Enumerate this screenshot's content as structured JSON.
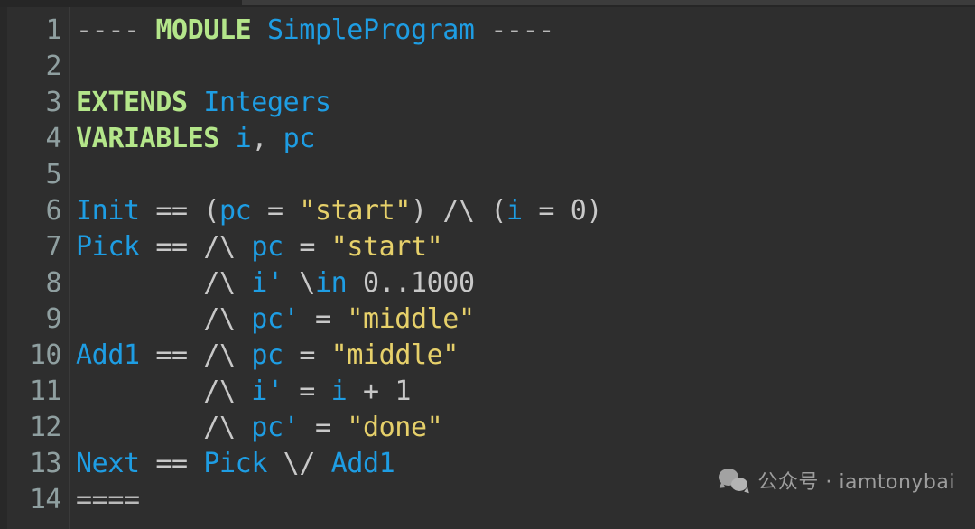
{
  "editor": {
    "language": "TLA+",
    "background_color": "#2e2e2e",
    "gutter_color": "#2e2e2e",
    "colors": {
      "keyword": "#b4e68a",
      "identifier": "#1e9de3",
      "string": "#e6d06a",
      "operator": "#c8c8c8",
      "line_number": "#8f9fa0",
      "background": "#2e2e2e"
    }
  },
  "gutter": {
    "line_numbers": [
      "1",
      "2",
      "3",
      "4",
      "5",
      "6",
      "7",
      "8",
      "9",
      "10",
      "11",
      "12",
      "13",
      "14"
    ]
  },
  "code": {
    "lines": [
      {
        "n": "1",
        "tokens": [
          {
            "t": "dash",
            "s": "----"
          },
          {
            "t": "plain",
            "s": " "
          },
          {
            "t": "kw",
            "s": "MODULE"
          },
          {
            "t": "plain",
            "s": " "
          },
          {
            "t": "id",
            "s": "SimpleProgram"
          },
          {
            "t": "plain",
            "s": " "
          },
          {
            "t": "dash",
            "s": "----"
          }
        ]
      },
      {
        "n": "2",
        "tokens": []
      },
      {
        "n": "3",
        "tokens": [
          {
            "t": "kw",
            "s": "EXTENDS"
          },
          {
            "t": "plain",
            "s": " "
          },
          {
            "t": "id",
            "s": "Integers"
          }
        ]
      },
      {
        "n": "4",
        "tokens": [
          {
            "t": "kw",
            "s": "VARIABLES"
          },
          {
            "t": "plain",
            "s": " "
          },
          {
            "t": "id",
            "s": "i"
          },
          {
            "t": "op",
            "s": ","
          },
          {
            "t": "plain",
            "s": " "
          },
          {
            "t": "id",
            "s": "pc"
          }
        ]
      },
      {
        "n": "5",
        "tokens": []
      },
      {
        "n": "6",
        "tokens": [
          {
            "t": "id",
            "s": "Init"
          },
          {
            "t": "plain",
            "s": " "
          },
          {
            "t": "op",
            "s": "=="
          },
          {
            "t": "plain",
            "s": " "
          },
          {
            "t": "op",
            "s": "("
          },
          {
            "t": "id",
            "s": "pc"
          },
          {
            "t": "plain",
            "s": " "
          },
          {
            "t": "op",
            "s": "="
          },
          {
            "t": "plain",
            "s": " "
          },
          {
            "t": "str",
            "s": "\"start\""
          },
          {
            "t": "op",
            "s": ")"
          },
          {
            "t": "plain",
            "s": " "
          },
          {
            "t": "op",
            "s": "/\\"
          },
          {
            "t": "plain",
            "s": " "
          },
          {
            "t": "op",
            "s": "("
          },
          {
            "t": "id",
            "s": "i"
          },
          {
            "t": "plain",
            "s": " "
          },
          {
            "t": "op",
            "s": "="
          },
          {
            "t": "plain",
            "s": " "
          },
          {
            "t": "num",
            "s": "0"
          },
          {
            "t": "op",
            "s": ")"
          }
        ]
      },
      {
        "n": "7",
        "tokens": [
          {
            "t": "id",
            "s": "Pick"
          },
          {
            "t": "plain",
            "s": " "
          },
          {
            "t": "op",
            "s": "=="
          },
          {
            "t": "plain",
            "s": " "
          },
          {
            "t": "op",
            "s": "/\\"
          },
          {
            "t": "plain",
            "s": " "
          },
          {
            "t": "id",
            "s": "pc"
          },
          {
            "t": "plain",
            "s": " "
          },
          {
            "t": "op",
            "s": "="
          },
          {
            "t": "plain",
            "s": " "
          },
          {
            "t": "str",
            "s": "\"start\""
          }
        ]
      },
      {
        "n": "8",
        "tokens": [
          {
            "t": "plain",
            "s": "        "
          },
          {
            "t": "op",
            "s": "/\\"
          },
          {
            "t": "plain",
            "s": " "
          },
          {
            "t": "id",
            "s": "i'"
          },
          {
            "t": "plain",
            "s": " "
          },
          {
            "t": "op",
            "s": "\\"
          },
          {
            "t": "id",
            "s": "in"
          },
          {
            "t": "plain",
            "s": " "
          },
          {
            "t": "num",
            "s": "0..1000"
          }
        ]
      },
      {
        "n": "9",
        "tokens": [
          {
            "t": "plain",
            "s": "        "
          },
          {
            "t": "op",
            "s": "/\\"
          },
          {
            "t": "plain",
            "s": " "
          },
          {
            "t": "id",
            "s": "pc'"
          },
          {
            "t": "plain",
            "s": " "
          },
          {
            "t": "op",
            "s": "="
          },
          {
            "t": "plain",
            "s": " "
          },
          {
            "t": "str",
            "s": "\"middle\""
          }
        ]
      },
      {
        "n": "10",
        "tokens": [
          {
            "t": "id",
            "s": "Add1"
          },
          {
            "t": "plain",
            "s": " "
          },
          {
            "t": "op",
            "s": "=="
          },
          {
            "t": "plain",
            "s": " "
          },
          {
            "t": "op",
            "s": "/\\"
          },
          {
            "t": "plain",
            "s": " "
          },
          {
            "t": "id",
            "s": "pc"
          },
          {
            "t": "plain",
            "s": " "
          },
          {
            "t": "op",
            "s": "="
          },
          {
            "t": "plain",
            "s": " "
          },
          {
            "t": "str",
            "s": "\"middle\""
          }
        ]
      },
      {
        "n": "11",
        "tokens": [
          {
            "t": "plain",
            "s": "        "
          },
          {
            "t": "op",
            "s": "/\\"
          },
          {
            "t": "plain",
            "s": " "
          },
          {
            "t": "id",
            "s": "i'"
          },
          {
            "t": "plain",
            "s": " "
          },
          {
            "t": "op",
            "s": "="
          },
          {
            "t": "plain",
            "s": " "
          },
          {
            "t": "id",
            "s": "i"
          },
          {
            "t": "plain",
            "s": " "
          },
          {
            "t": "op",
            "s": "+"
          },
          {
            "t": "plain",
            "s": " "
          },
          {
            "t": "num",
            "s": "1"
          }
        ]
      },
      {
        "n": "12",
        "tokens": [
          {
            "t": "plain",
            "s": "        "
          },
          {
            "t": "op",
            "s": "/\\"
          },
          {
            "t": "plain",
            "s": " "
          },
          {
            "t": "id",
            "s": "pc'"
          },
          {
            "t": "plain",
            "s": " "
          },
          {
            "t": "op",
            "s": "="
          },
          {
            "t": "plain",
            "s": " "
          },
          {
            "t": "str",
            "s": "\"done\""
          }
        ]
      },
      {
        "n": "13",
        "tokens": [
          {
            "t": "id",
            "s": "Next"
          },
          {
            "t": "plain",
            "s": " "
          },
          {
            "t": "op",
            "s": "=="
          },
          {
            "t": "plain",
            "s": " "
          },
          {
            "t": "id",
            "s": "Pick"
          },
          {
            "t": "plain",
            "s": " "
          },
          {
            "t": "op",
            "s": "\\/"
          },
          {
            "t": "plain",
            "s": " "
          },
          {
            "t": "id",
            "s": "Add1"
          }
        ]
      },
      {
        "n": "14",
        "tokens": [
          {
            "t": "dash",
            "s": "===="
          }
        ]
      }
    ]
  },
  "watermark": {
    "icon": "wechat-icon",
    "text": "公众号 · iamtonybai"
  }
}
